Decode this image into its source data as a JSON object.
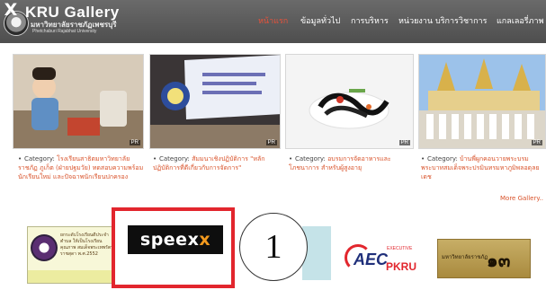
{
  "header": {
    "close_glyph": "X",
    "site_title": "KRU Gallery",
    "site_subtitle_thai": "มหาวิทยาลัยราชภัฏเพชรบุรี",
    "site_subtitle_en": "Phetchaburi Rajabhat University",
    "nav": [
      {
        "label": "หน้าแรก",
        "active": true
      },
      {
        "label": "ข้อมูลทั่วไป",
        "active": false
      },
      {
        "label": "การบริหาร",
        "active": false
      },
      {
        "label": "หน่วยงาน",
        "active": false
      },
      {
        "label": "บริการวิชาการ",
        "active": false
      },
      {
        "label": "แกลเลอรี่ภาพ",
        "active": false
      }
    ]
  },
  "gallery": {
    "badge": "PR",
    "items": [
      {
        "category_label": "Category:",
        "category_value": "โรงเรียนสาธิตมหาวิทยาลัยราชภัฏ ภูเก็ต (ฝ่ายปฐมวัย) ทดสอบความพร้อมนักเรียนใหม่ และปัจฉาพนักเรียนปกครอง"
      },
      {
        "category_label": "Category:",
        "category_value": "สัมมนาเชิงปฏิบัติการ \"หลักปฏิบัติการที่ดีเกี่ยวกับการจัดการ\""
      },
      {
        "category_label": "Category:",
        "category_value": "อบรมการจัดอาหารและโภชนาการ สำหรับผู้สูงอายุ"
      },
      {
        "category_label": "Category:",
        "category_value": "บ้านพี่ผูกคอนวายพระบรมพระบาทสมเด็จพระปรมินทรมหาภูมิพลอดุลยเดช"
      }
    ],
    "more_link": "More Gallery.."
  },
  "partners": {
    "p1_text": "ยกระดับโรงเรียนดีประจำตำบล ให้เป็นโรงเรียนคุณภาพ สมเด็จพระเทพรัตนราชสุดา พ.ศ.2552",
    "speexx_label_a": "speex",
    "speexx_label_b": "x",
    "annotation_number": "1",
    "aec": "AEC",
    "aec_exec": "EXECUTIVE",
    "aec_pkru": "PKRU",
    "p5_text": "มหาวิทยาลัยราชภัฏ",
    "p5_num": "๑๓"
  },
  "colors": {
    "accent": "#e8523b",
    "link": "#d9532b",
    "highlight_box": "#e2262d"
  }
}
